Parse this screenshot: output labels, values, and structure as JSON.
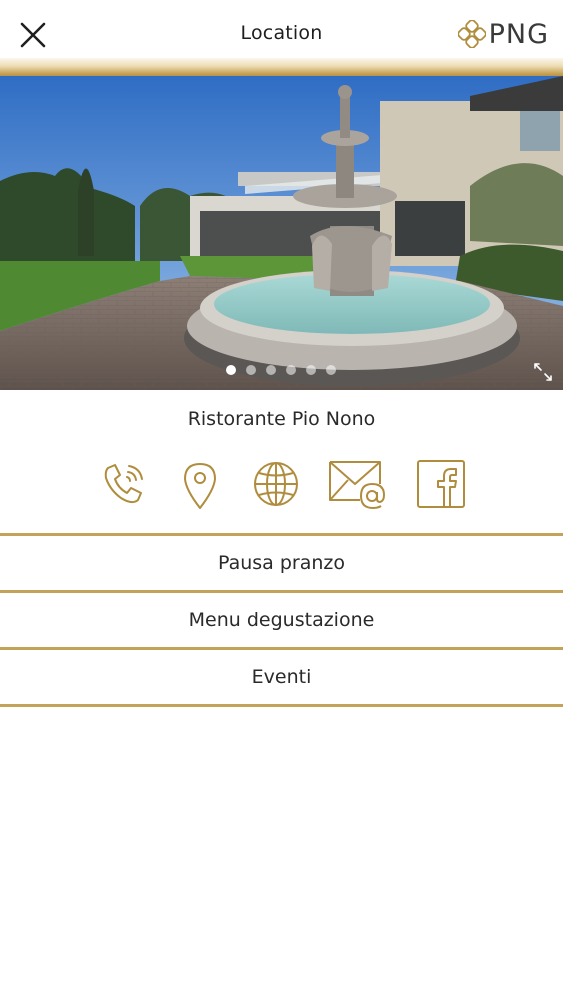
{
  "header": {
    "title": "Location",
    "close_icon": "close-icon",
    "logo_text": "PNG",
    "logo_icon": "quatrefoil-logo-icon"
  },
  "colors": {
    "gold": "#c3a35a",
    "gold_dark": "#b08d3e",
    "text": "#2a2a2a"
  },
  "gallery": {
    "image": "restaurant-courtyard-fountain-photo",
    "slide_count": 6,
    "active_slide": 1,
    "expand_icon": "expand-icon"
  },
  "venue": {
    "name": "Ristorante Pio Nono"
  },
  "actions": [
    {
      "icon": "phone-icon"
    },
    {
      "icon": "map-pin-icon"
    },
    {
      "icon": "globe-icon"
    },
    {
      "icon": "email-icon"
    },
    {
      "icon": "facebook-icon"
    }
  ],
  "menu": {
    "items": [
      {
        "label": "Pausa pranzo"
      },
      {
        "label": "Menu degustazione"
      },
      {
        "label": "Eventi"
      }
    ]
  }
}
